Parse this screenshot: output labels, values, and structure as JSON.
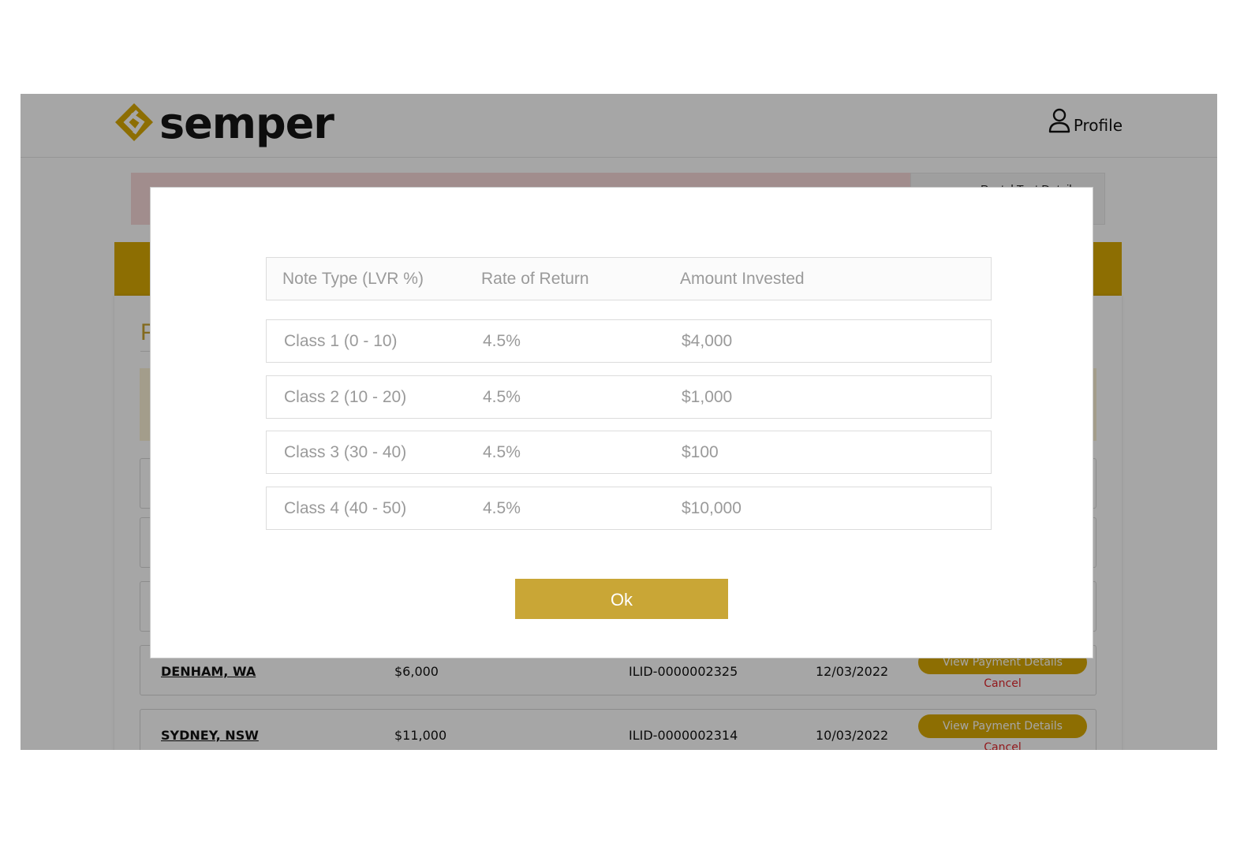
{
  "header": {
    "logo_text": "semper",
    "profile_label": "Profile"
  },
  "background": {
    "alert_side_text": "Postal Test Details",
    "section_initial": "P",
    "rows": [
      {
        "location": "DENHAM, WA",
        "amount": "$6,000",
        "reference": "ILID-0000002325",
        "date": "12/03/2022",
        "action_label": "View Payment Details",
        "cancel_label": "Cancel"
      },
      {
        "location": "SYDNEY, NSW",
        "amount": "$11,000",
        "reference": "ILID-0000002314",
        "date": "10/03/2022",
        "action_label": "View Payment Details",
        "cancel_label": "Cancel"
      }
    ]
  },
  "modal": {
    "columns": [
      "Note Type (LVR %)",
      "Rate of Return",
      "Amount Invested"
    ],
    "rows": [
      {
        "note_type": "Class 1 (0 - 10)",
        "rate": "4.5%",
        "amount": "$4,000"
      },
      {
        "note_type": "Class 2 (10 - 20)",
        "rate": "4.5%",
        "amount": "$1,000"
      },
      {
        "note_type": "Class 3 (30 - 40)",
        "rate": "4.5%",
        "amount": "$100"
      },
      {
        "note_type": "Class 4 (40 - 50)",
        "rate": "4.5%",
        "amount": "$10,000"
      }
    ],
    "ok_label": "Ok"
  },
  "colors": {
    "brand_gold": "#d9aa04",
    "button_gold": "#c9a636",
    "cancel_red": "#e0262b"
  },
  "icons": {
    "logo": "semper-diamond-logo-icon",
    "profile": "user-icon"
  }
}
